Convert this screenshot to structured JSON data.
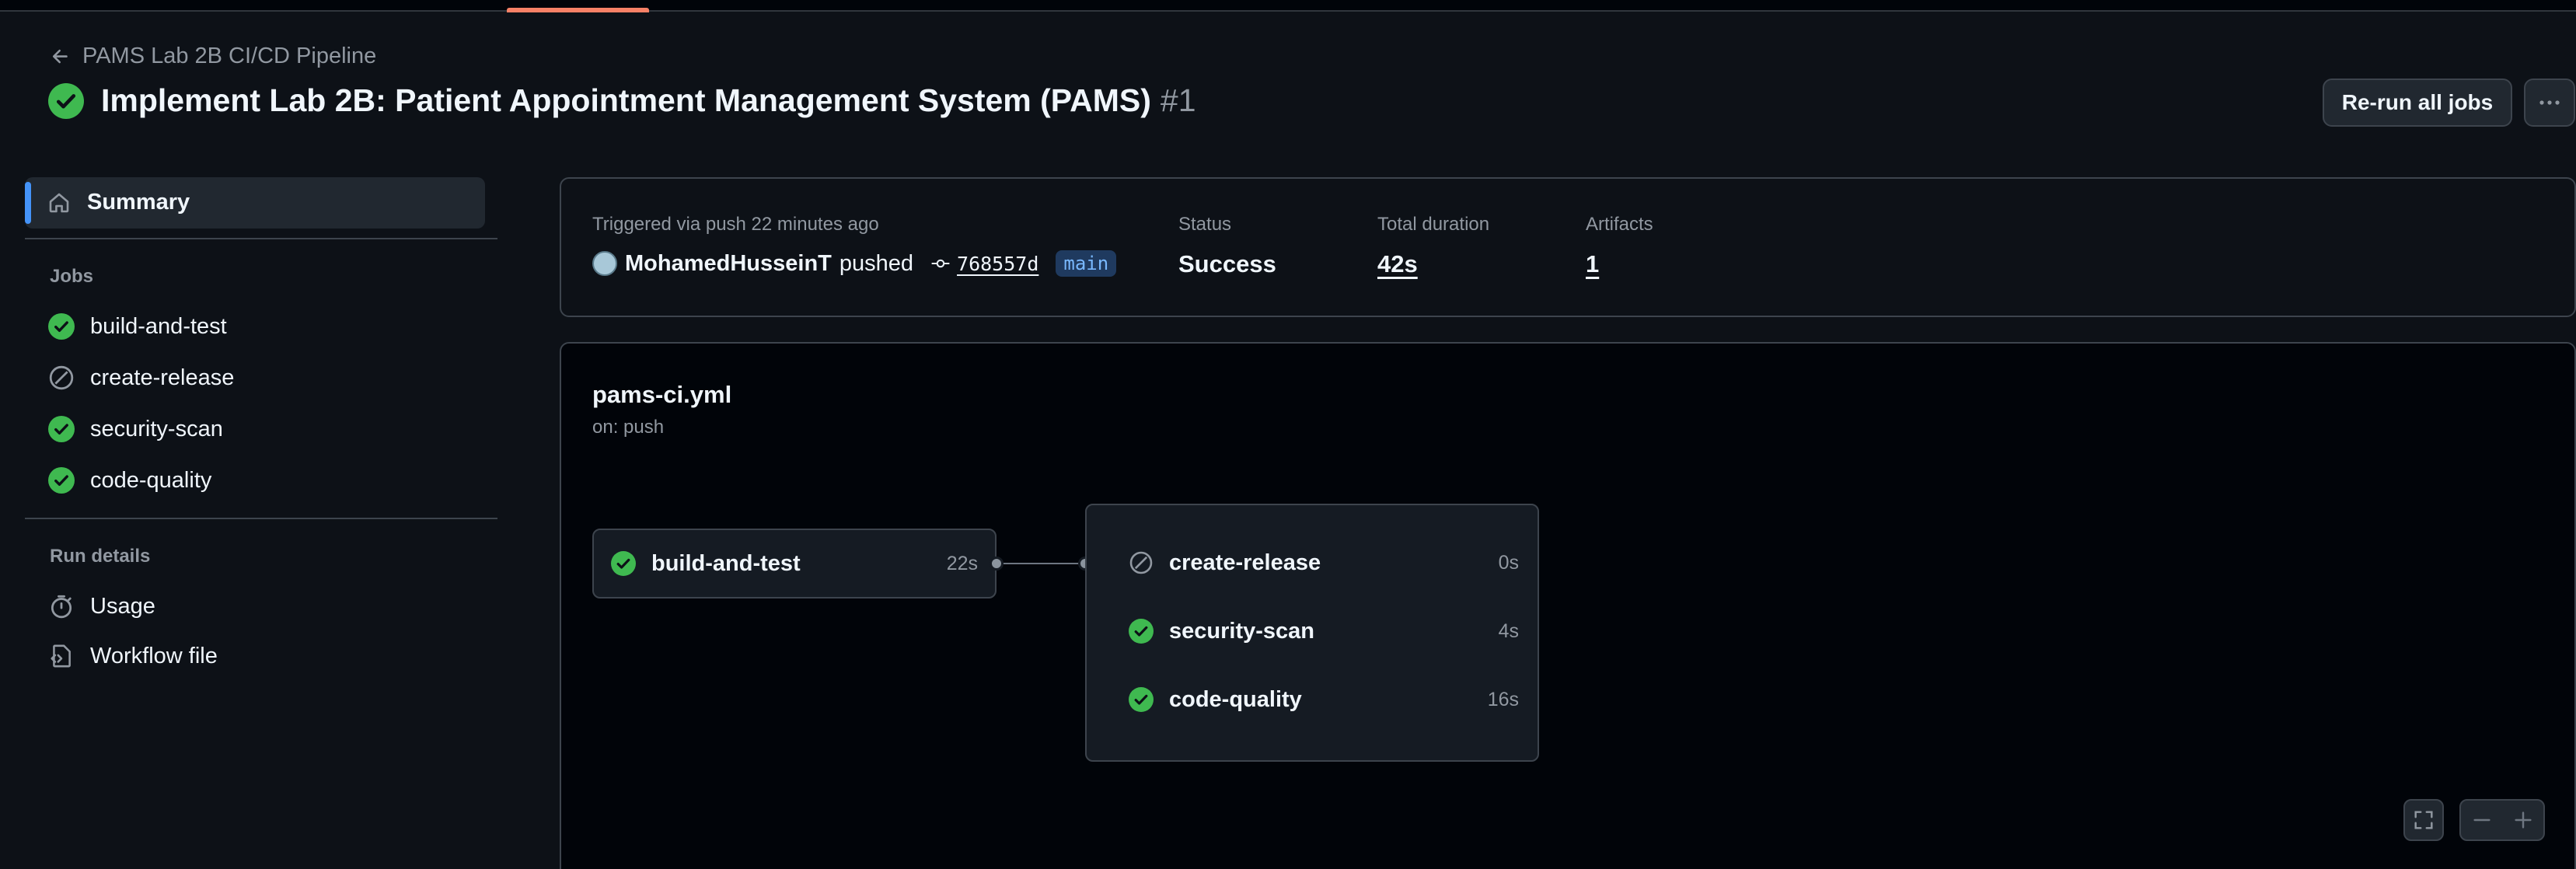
{
  "header": {
    "back_label": "PAMS Lab 2B CI/CD Pipeline",
    "title": "Implement Lab 2B: Patient Appointment Management System (PAMS)",
    "run_number": "#1",
    "rerun_label": "Re-run all jobs",
    "more_label": "···"
  },
  "sidebar": {
    "summary_label": "Summary",
    "jobs_title": "Jobs",
    "jobs": [
      {
        "label": "build-and-test",
        "status": "success"
      },
      {
        "label": "create-release",
        "status": "skipped"
      },
      {
        "label": "security-scan",
        "status": "success"
      },
      {
        "label": "code-quality",
        "status": "success"
      }
    ],
    "run_details_title": "Run details",
    "run_details": [
      {
        "label": "Usage",
        "icon": "stopwatch-icon"
      },
      {
        "label": "Workflow file",
        "icon": "file-code-icon"
      }
    ]
  },
  "info": {
    "trigger_label": "Triggered via push 22 minutes ago",
    "actor": "MohamedHusseinT",
    "action": "pushed",
    "commit": "768557d",
    "branch": "main",
    "status_label": "Status",
    "status_value": "Success",
    "duration_label": "Total duration",
    "duration_value": "42s",
    "artifacts_label": "Artifacts",
    "artifacts_value": "1"
  },
  "workflow": {
    "file": "pams-ci.yml",
    "trigger": "on: push",
    "first_job": {
      "name": "build-and-test",
      "duration": "22s",
      "status": "success"
    },
    "dependent_jobs": [
      {
        "name": "create-release",
        "duration": "0s",
        "status": "skipped"
      },
      {
        "name": "security-scan",
        "duration": "4s",
        "status": "success"
      },
      {
        "name": "code-quality",
        "duration": "16s",
        "status": "success"
      }
    ]
  },
  "colors": {
    "success": "#3fb950",
    "accent": "#4493f8",
    "background": "#0d1117"
  }
}
